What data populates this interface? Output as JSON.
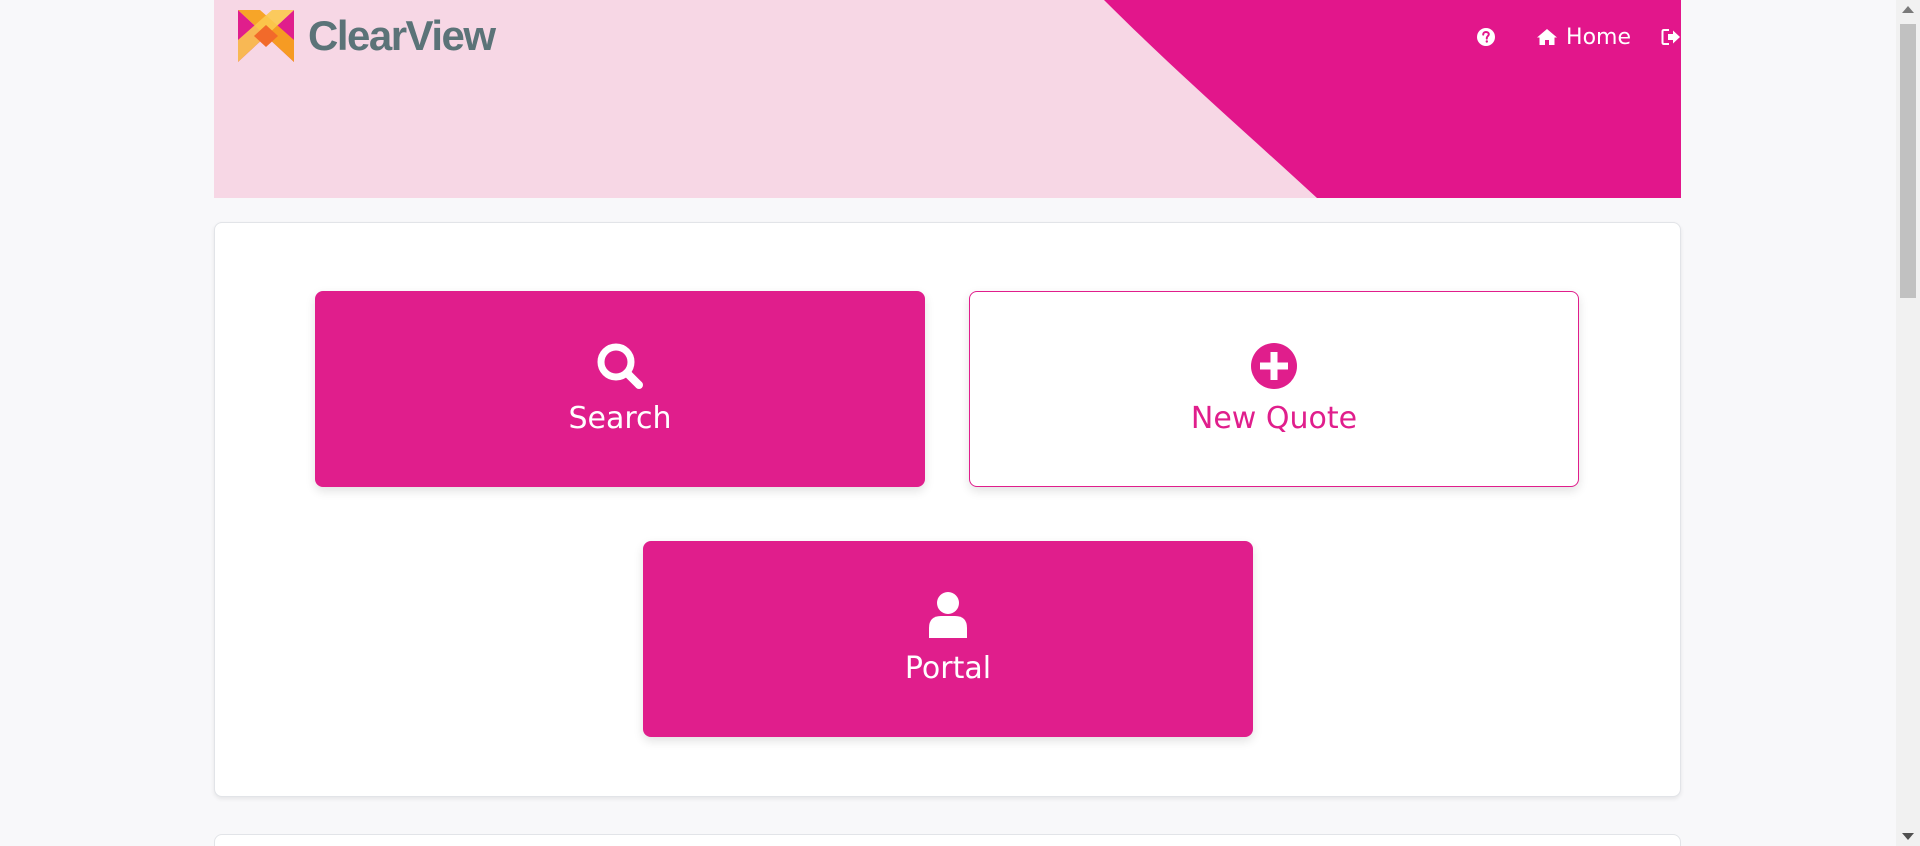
{
  "brand": {
    "name": "ClearView",
    "accent": "#e01e8c",
    "banner_bg": "#f7d7e5",
    "logo_text_color": "#5b7378"
  },
  "nav": {
    "help_icon": "question-circle-icon",
    "home_icon": "home-icon",
    "home_label": "Home",
    "logout_icon": "sign-out-icon"
  },
  "tiles": [
    {
      "label": "Search",
      "icon": "search-icon",
      "style": "filled"
    },
    {
      "label": "New Quote",
      "icon": "plus-circle-icon",
      "style": "outline"
    },
    {
      "label": "Portal",
      "icon": "user-icon",
      "style": "filled"
    }
  ]
}
